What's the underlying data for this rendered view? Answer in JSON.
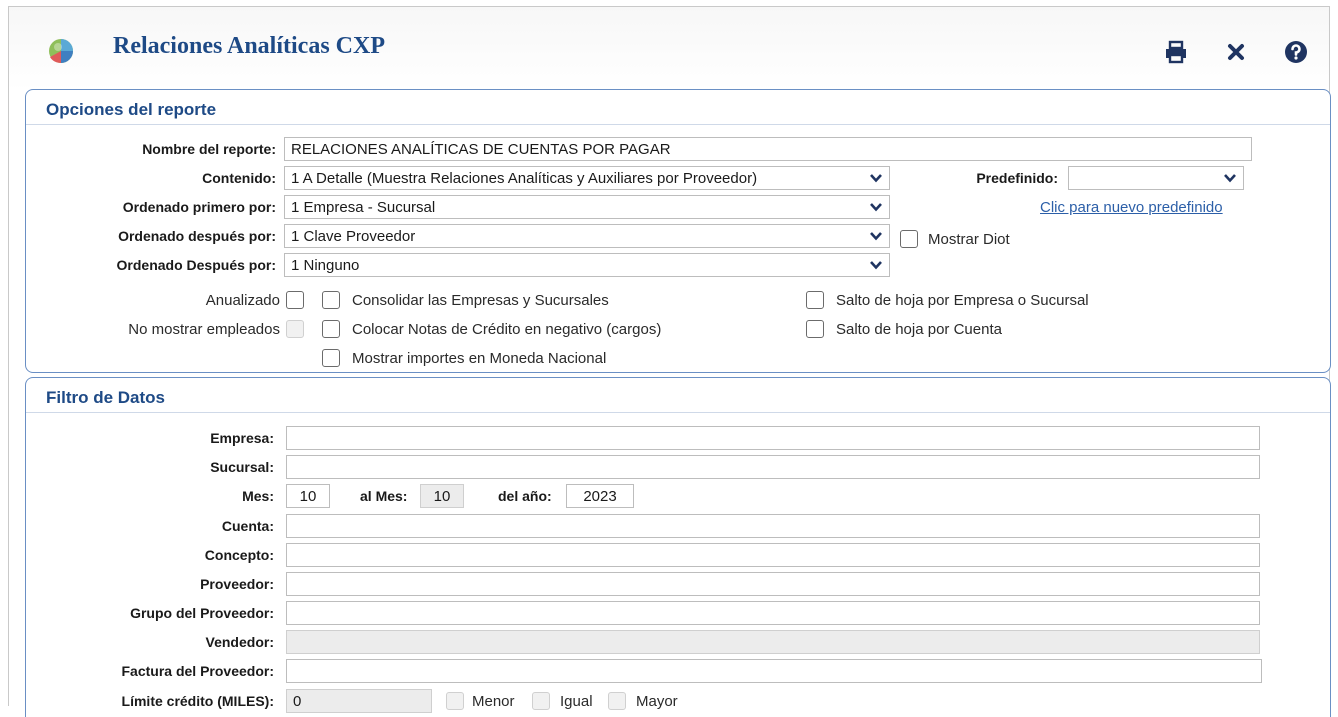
{
  "header": {
    "title": "Relaciones Analíticas CXP",
    "icons": [
      "app-logo-icon",
      "print-icon",
      "close-icon",
      "help-icon"
    ]
  },
  "opciones": {
    "title": "Opciones del reporte",
    "nombre_label": "Nombre del reporte:",
    "nombre_value": "RELACIONES ANALÍTICAS DE CUENTAS POR PAGAR",
    "contenido_label": "Contenido:",
    "contenido_value": "1 A Detalle (Muestra Relaciones Analíticas y Auxiliares por Proveedor)",
    "predefinido_label": "Predefinido:",
    "predefinido_value": "",
    "nuevo_predefinido_link": "Clic para nuevo predefinido",
    "ordenado_primero_label": "Ordenado primero por:",
    "ordenado_primero_value": "1 Empresa - Sucursal",
    "ordenado_despues_label": "Ordenado después por:",
    "ordenado_despues_value": "1 Clave Proveedor",
    "mostrar_diot_label": "Mostrar Diot",
    "ordenado_despues2_label": "Ordenado Después por:",
    "ordenado_despues2_value": "1 Ninguno",
    "anualizado_label": "Anualizado",
    "no_mostrar_empleados_label": "No mostrar empleados",
    "consolidar_label": "Consolidar las Empresas y Sucursales",
    "colocar_notas_label": "Colocar Notas de Crédito en negativo (cargos)",
    "mostrar_importes_label": "Mostrar importes en Moneda Nacional",
    "salto_empresa_label": "Salto de hoja por Empresa o Sucursal",
    "salto_cuenta_label": "Salto de hoja por Cuenta"
  },
  "filtro": {
    "title": "Filtro de Datos",
    "empresa_label": "Empresa:",
    "empresa_value": "",
    "sucursal_label": "Sucursal:",
    "sucursal_value": "",
    "mes_label": "Mes:",
    "mes_value": "10",
    "al_mes_label": "al Mes:",
    "al_mes_value": "10",
    "anio_label": "del año:",
    "anio_value": "2023",
    "cuenta_label": "Cuenta:",
    "concepto_label": "Concepto:",
    "proveedor_label": "Proveedor:",
    "grupo_proveedor_label": "Grupo del Proveedor:",
    "vendedor_label": "Vendedor:",
    "factura_label": "Factura del Proveedor:",
    "limite_label": "Límite crédito (MILES):",
    "limite_value": "0",
    "menor_label": "Menor",
    "igual_label": "Igual",
    "mayor_label": "Mayor"
  },
  "colors": {
    "title_blue": "#1e4a86",
    "panel_border": "#6a8fc4",
    "link_blue": "#2c5fa8",
    "icon_navy": "#1f3461"
  }
}
